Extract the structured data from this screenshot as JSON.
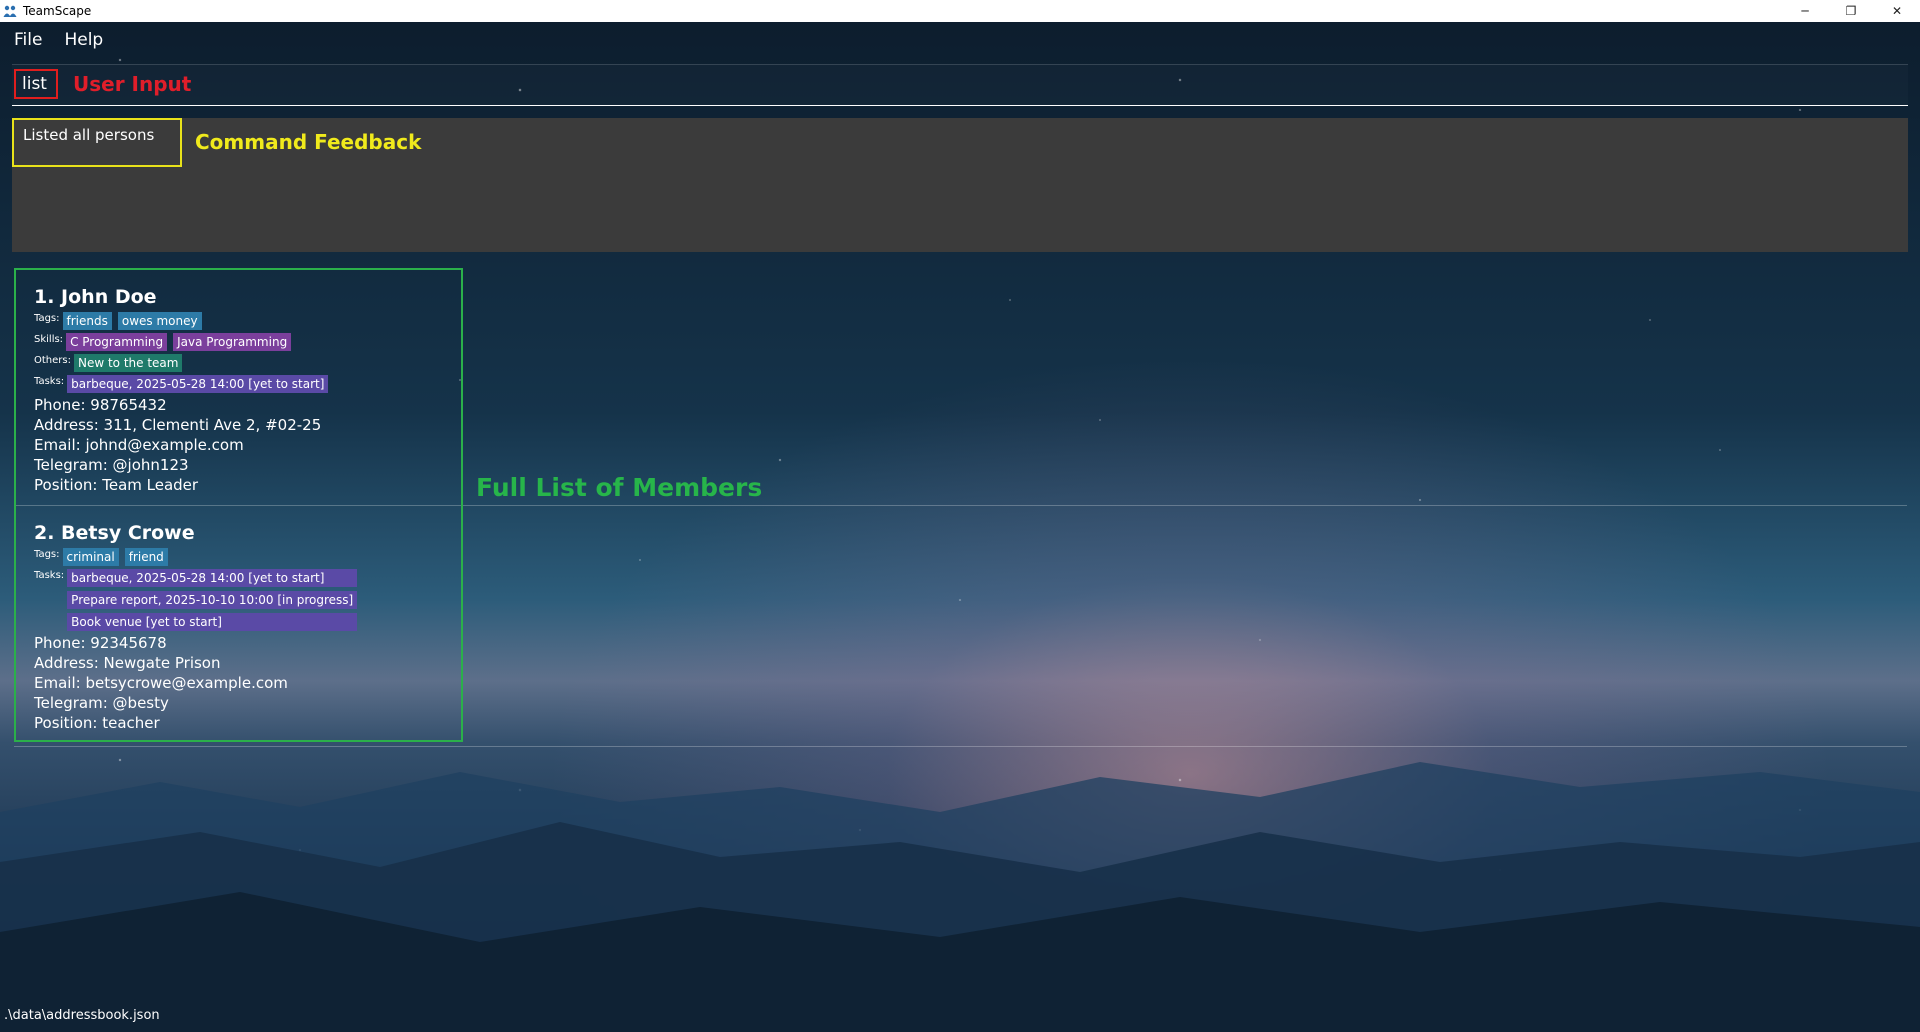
{
  "window": {
    "title": "TeamScape",
    "minimize": "─",
    "restore": "❐",
    "close": "✕"
  },
  "menu": {
    "file": "File",
    "help": "Help"
  },
  "command": {
    "value": "list",
    "annotation": "User Input"
  },
  "result": {
    "text": "Listed all persons",
    "annotation": "Command Feedback"
  },
  "list": {
    "annotation": "Full List of Members",
    "persons": [
      {
        "name": "1. John Doe",
        "tags_label": "Tags:",
        "tags": [
          "friends",
          "owes money"
        ],
        "skills_label": "Skills:",
        "skills": [
          "C Programming",
          "Java Programming"
        ],
        "others_label": "Others:",
        "others": [
          "New to the team"
        ],
        "tasks_label": "Tasks:",
        "tasks": [
          "barbeque, 2025-05-28 14:00 [yet to start]"
        ],
        "phone": "Phone: 98765432",
        "address": "Address: 311, Clementi Ave 2, #02-25",
        "email": "Email: johnd@example.com",
        "telegram": "Telegram: @john123",
        "position": "Position: Team Leader"
      },
      {
        "name": "2. Betsy Crowe",
        "tags_label": "Tags:",
        "tags": [
          "criminal",
          "friend"
        ],
        "tasks_label": "Tasks:",
        "tasks": [
          "barbeque, 2025-05-28 14:00 [yet to start]",
          "Prepare report, 2025-10-10 10:00 [in progress]",
          "Book venue [yet to start]"
        ],
        "phone": "Phone: 92345678",
        "address": "Address: Newgate Prison",
        "email": "Email: betsycrowe@example.com",
        "telegram": "Telegram: @besty",
        "position": "Position: teacher"
      }
    ]
  },
  "status": {
    "path": ".\\data\\addressbook.json"
  },
  "colors": {
    "annotation_red": "#e01e2a",
    "annotation_yellow": "#f0ea1c",
    "annotation_green": "#27b54a",
    "result_bg": "#3b3b3b"
  }
}
